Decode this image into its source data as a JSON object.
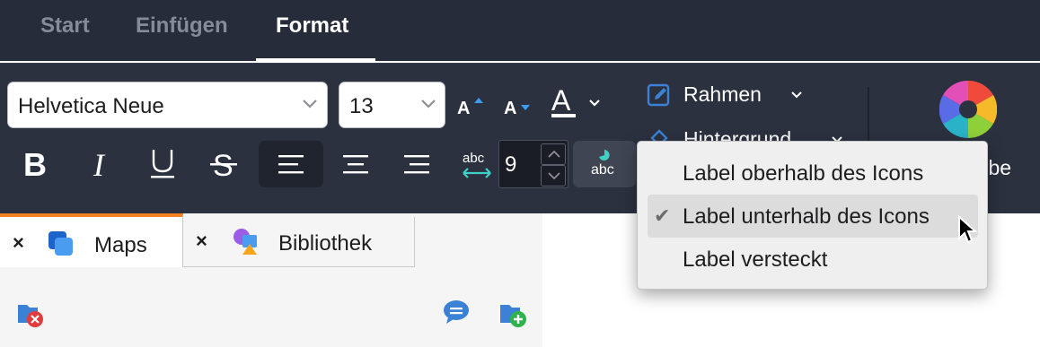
{
  "tabs": [
    "Start",
    "Einfügen",
    "Format"
  ],
  "active_tab": "Format",
  "ribbon": {
    "font_family": "Helvetica Neue",
    "font_size": "13",
    "line_spacing": "9",
    "spacing_icon_text": "abc",
    "label_toggle_text": "abc",
    "rahmen_label": "Rahmen",
    "hintergrund_label": "Hintergrund",
    "farbe_label": "arbe"
  },
  "documents": [
    {
      "label": "Maps",
      "active": true
    },
    {
      "label": "Bibliothek",
      "active": false
    }
  ],
  "menu": {
    "items": [
      {
        "label": "Label oberhalb des Icons",
        "checked": false
      },
      {
        "label": "Label unterhalb des Icons",
        "checked": true
      },
      {
        "label": "Label versteckt",
        "checked": false
      }
    ],
    "check_mark": "✔"
  },
  "colors": {
    "accent": "#3b82d6",
    "tab_underline": "#ffffff",
    "doc_tab_active": "#f5821f"
  }
}
